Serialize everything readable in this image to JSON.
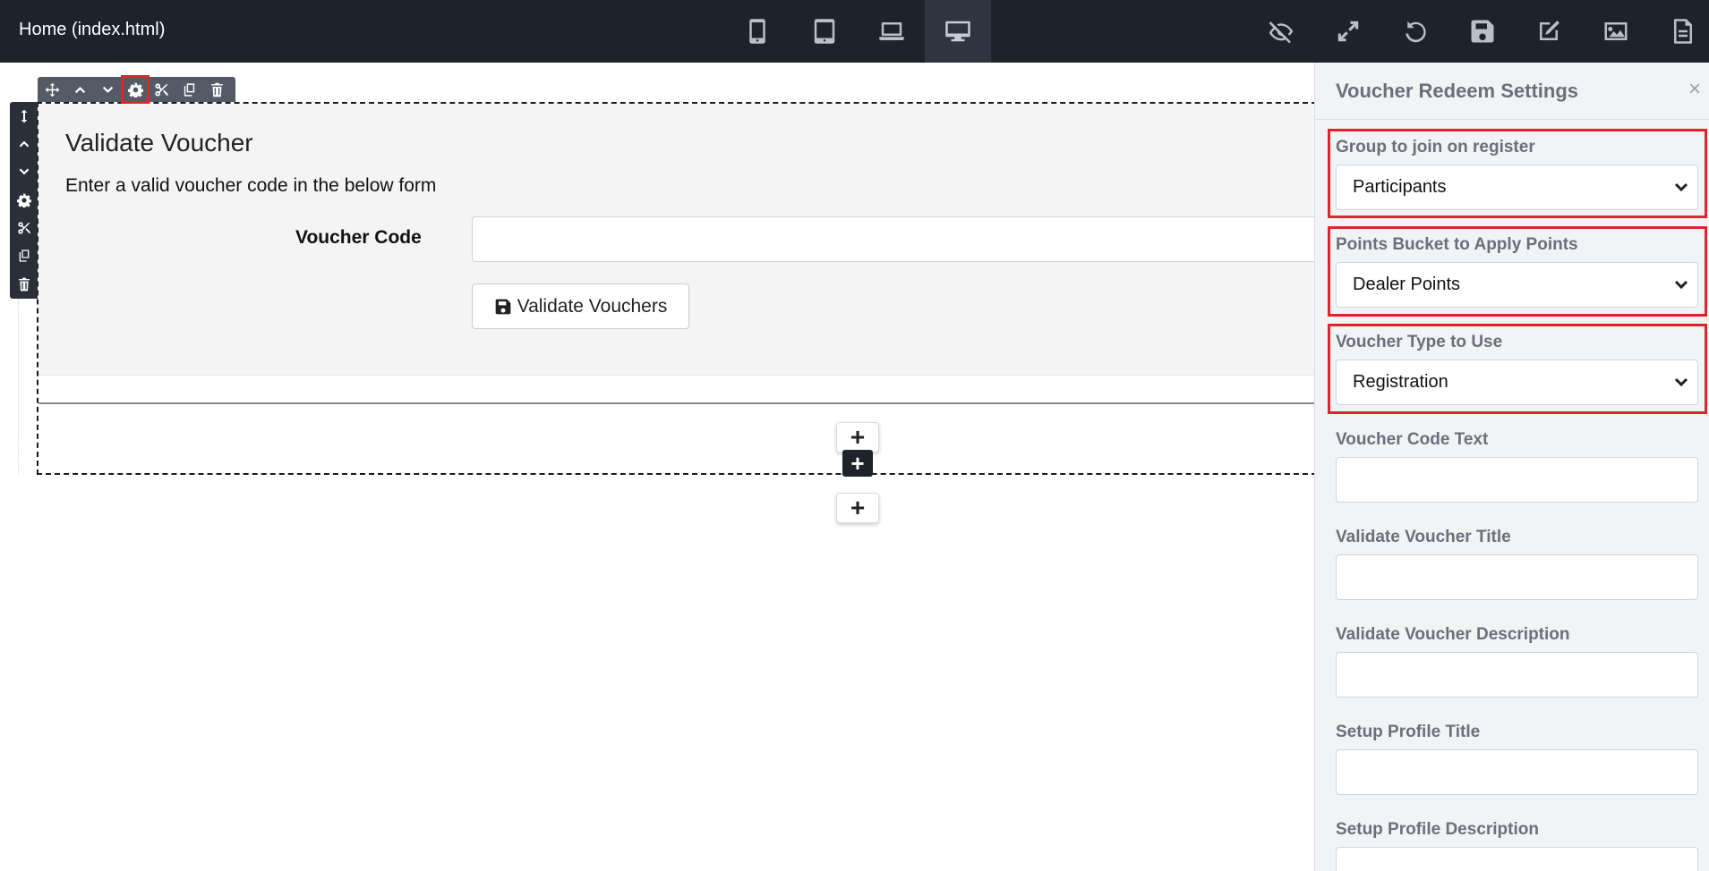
{
  "topbar": {
    "page_name": "Home (index.html)",
    "device_buttons": [
      {
        "name": "mobile-view",
        "icon": "mobile-icon",
        "active": false
      },
      {
        "name": "tablet-view",
        "icon": "tablet-icon",
        "active": false
      },
      {
        "name": "laptop-view",
        "icon": "laptop-icon",
        "active": false
      },
      {
        "name": "desktop-view",
        "icon": "desktop-icon",
        "active": true
      }
    ],
    "actions": [
      "eye-slash-icon",
      "expand-icon",
      "undo-icon",
      "save-icon",
      "edit-icon",
      "image-icon",
      "file-icon"
    ]
  },
  "element_toolbar": {
    "icons": [
      "move-icon",
      "chevron-up-icon",
      "chevron-down-icon",
      "gear-icon",
      "cut-icon",
      "copy-icon",
      "trash-icon"
    ],
    "highlighted": "gear-icon"
  },
  "side_toolbar": {
    "icons": [
      "resize-vertical-icon",
      "chevron-up-icon",
      "chevron-down-icon",
      "gear-icon",
      "cut-icon",
      "copy-icon",
      "trash-icon"
    ]
  },
  "form": {
    "title": "Validate Voucher",
    "description": "Enter a valid voucher code in the below form",
    "voucher_label": "Voucher Code",
    "voucher_value": "",
    "button_label": "Validate Vouchers",
    "button_icon": "save-icon"
  },
  "add_buttons": [
    "+",
    "+",
    "+"
  ],
  "panel": {
    "title": "Voucher Redeem Settings",
    "close": "×",
    "fields": [
      {
        "label": "Group to join on register",
        "type": "select",
        "value": "Participants",
        "highlighted": true
      },
      {
        "label": "Points Bucket to Apply Points",
        "type": "select",
        "value": "Dealer Points",
        "highlighted": true
      },
      {
        "label": "Voucher Type to Use",
        "type": "select",
        "value": "Registration",
        "highlighted": true
      },
      {
        "label": "Voucher Code Text",
        "type": "text",
        "value": ""
      },
      {
        "label": "Validate Voucher Title",
        "type": "text",
        "value": ""
      },
      {
        "label": "Validate Voucher Description",
        "type": "text",
        "value": ""
      },
      {
        "label": "Setup Profile Title",
        "type": "text",
        "value": ""
      },
      {
        "label": "Setup Profile Description",
        "type": "text",
        "value": ""
      }
    ]
  },
  "colors": {
    "topbar": "#1e222b",
    "highlight": "#e0242b",
    "panel_bg": "#f2f3f5",
    "label": "#6a707a"
  }
}
